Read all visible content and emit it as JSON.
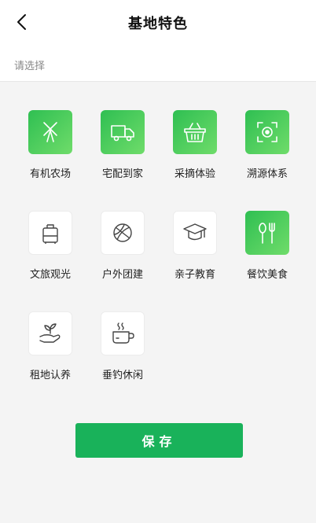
{
  "header": {
    "title": "基地特色"
  },
  "hint": "请选择",
  "features": [
    {
      "label": "有机农场",
      "selected": true,
      "icon": "windmill-icon"
    },
    {
      "label": "宅配到家",
      "selected": true,
      "icon": "delivery-truck-icon"
    },
    {
      "label": "采摘体验",
      "selected": true,
      "icon": "basket-icon"
    },
    {
      "label": "溯源体系",
      "selected": true,
      "icon": "target-scan-icon"
    },
    {
      "label": "文旅观光",
      "selected": false,
      "icon": "luggage-icon"
    },
    {
      "label": "户外团建",
      "selected": false,
      "icon": "basketball-icon"
    },
    {
      "label": "亲子教育",
      "selected": false,
      "icon": "graduation-cap-icon"
    },
    {
      "label": "餐饮美食",
      "selected": true,
      "icon": "cutlery-icon"
    },
    {
      "label": "租地认养",
      "selected": false,
      "icon": "sprout-hand-icon"
    },
    {
      "label": "垂钓休闲",
      "selected": false,
      "icon": "hot-cup-icon"
    }
  ],
  "save_label": "保存",
  "colors": {
    "accent": "#19b25a",
    "tile_gradient_start": "#2fbf52",
    "tile_gradient_end": "#6fdc6a"
  }
}
